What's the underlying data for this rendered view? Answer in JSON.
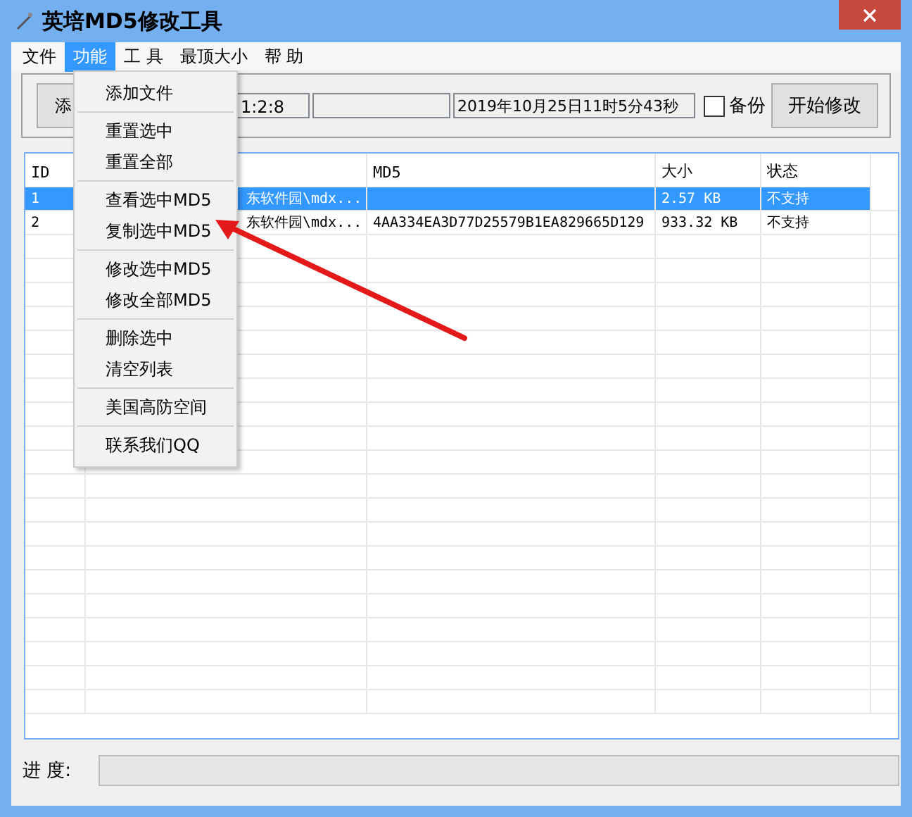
{
  "window": {
    "title": "英培MD5修改工具"
  },
  "menu_bar": [
    {
      "label": "文件",
      "selected": false
    },
    {
      "label": "功能",
      "selected": true
    },
    {
      "label": "工 具",
      "selected": false
    },
    {
      "label": "最顶大小",
      "selected": false
    },
    {
      "label": "帮 助",
      "selected": false
    }
  ],
  "toolbar": {
    "add_button": "添",
    "time_field": "1:2:8",
    "date_field": "2019年10月25日11时5分43秒",
    "backup": {
      "label": "备份",
      "checked": false
    },
    "start_button": "开始修改"
  },
  "table": {
    "columns": [
      "ID",
      "MD5",
      "大小",
      "状态"
    ],
    "rows": [
      {
        "id": "1",
        "column_2": "东软件园\\mdx...",
        "size": "2.57 KB",
        "status": "不支持",
        "selected": true
      },
      {
        "id": "2",
        "column_2": "东软件园\\mdx...",
        "md5": "4AA334EA3D77D25579B1EA829665D129",
        "size": "933.32 KB",
        "status": "不支持",
        "selected": false
      }
    ]
  },
  "progress": {
    "label": "进 度:",
    "level": 0
  },
  "dropdown": {
    "groups": [
      [
        "添加文件"
      ],
      [
        "重置选中",
        "重置全部"
      ],
      [
        "查看选中MD5",
        "复制选中MD5"
      ],
      [
        "修改选中MD5",
        "修改全部MD5"
      ],
      [
        "删除选中",
        "清空列表"
      ],
      [
        "美国高防空间"
      ],
      [
        "联系我们QQ"
      ]
    ]
  }
}
